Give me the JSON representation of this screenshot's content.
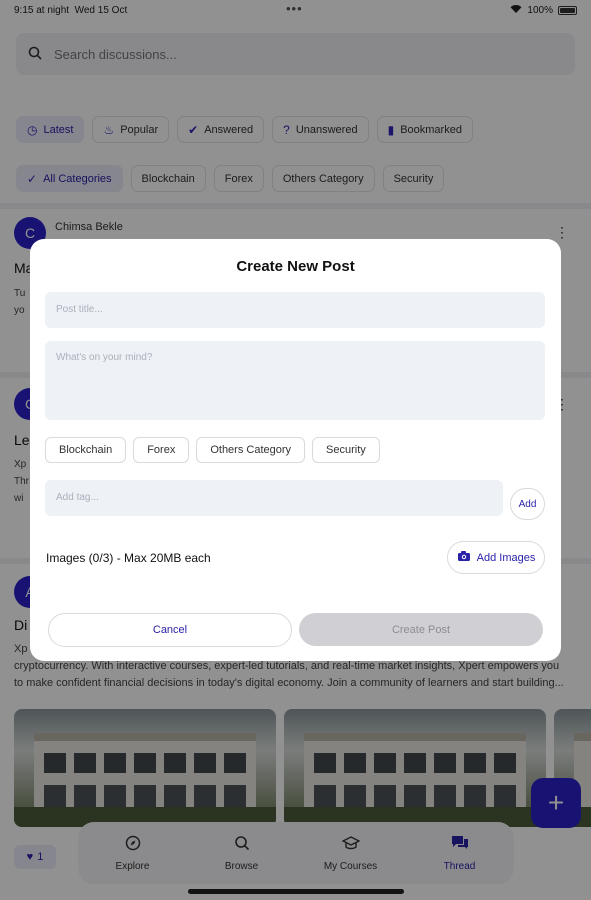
{
  "status_bar": {
    "time": "9:15 at night",
    "date": "Wed 15 Oct",
    "battery": "100%",
    "dots": "•••"
  },
  "search": {
    "placeholder": "Search discussions..."
  },
  "filters": [
    {
      "label": "Latest",
      "icon": "clock-icon",
      "active": true
    },
    {
      "label": "Popular",
      "icon": "flame-icon",
      "active": false
    },
    {
      "label": "Answered",
      "icon": "check-circle-icon",
      "active": false
    },
    {
      "label": "Unanswered",
      "icon": "question-circle-icon",
      "active": false
    },
    {
      "label": "Bookmarked",
      "icon": "bookmark-icon",
      "active": false
    }
  ],
  "categories": [
    {
      "label": "All Categories",
      "active": true
    },
    {
      "label": "Blockchain",
      "active": false
    },
    {
      "label": "Forex",
      "active": false
    },
    {
      "label": "Others Category",
      "active": false
    },
    {
      "label": "Security",
      "active": false
    }
  ],
  "posts": [
    {
      "avatar": "C",
      "author": "Chimsa Bekle",
      "title": "Ma",
      "body": "Tu\nyo"
    },
    {
      "avatar": "C",
      "title": "Le",
      "body": "Xp\nThr\nwi"
    },
    {
      "avatar": "A",
      "title": "Di",
      "body_line1": "Xp",
      "body_line2": "cryptocurrency. With interactive courses, expert-led tutorials, and real-time market insights, Xpert empowers you",
      "body_line3": "to make confident financial decisions in today's digital economy. Join a community of learners and start building..."
    }
  ],
  "like_count": "1",
  "bottom_nav": [
    {
      "label": "Explore",
      "icon": "compass-icon",
      "active": false
    },
    {
      "label": "Browse",
      "icon": "search-icon",
      "active": false
    },
    {
      "label": "My Courses",
      "icon": "graduation-cap-icon",
      "active": false
    },
    {
      "label": "Thread",
      "icon": "chat-bubbles-icon",
      "active": true
    }
  ],
  "modal": {
    "title": "Create New Post",
    "post_title_placeholder": "Post title...",
    "body_placeholder": "What's on your mind?",
    "tags": [
      "Blockchain",
      "Forex",
      "Others Category",
      "Security"
    ],
    "tag_placeholder": "Add tag...",
    "add_label": "Add",
    "images_label": "Images (0/3) - Max 20MB each",
    "add_images_label": "Add Images",
    "cancel_label": "Cancel",
    "create_label": "Create Post"
  },
  "colors": {
    "accent": "#2b23c9",
    "chip_active_bg": "#ecebfb",
    "overlay": "rgba(0,0,0,0.43)",
    "disabled_button": "#d0d0d4"
  }
}
